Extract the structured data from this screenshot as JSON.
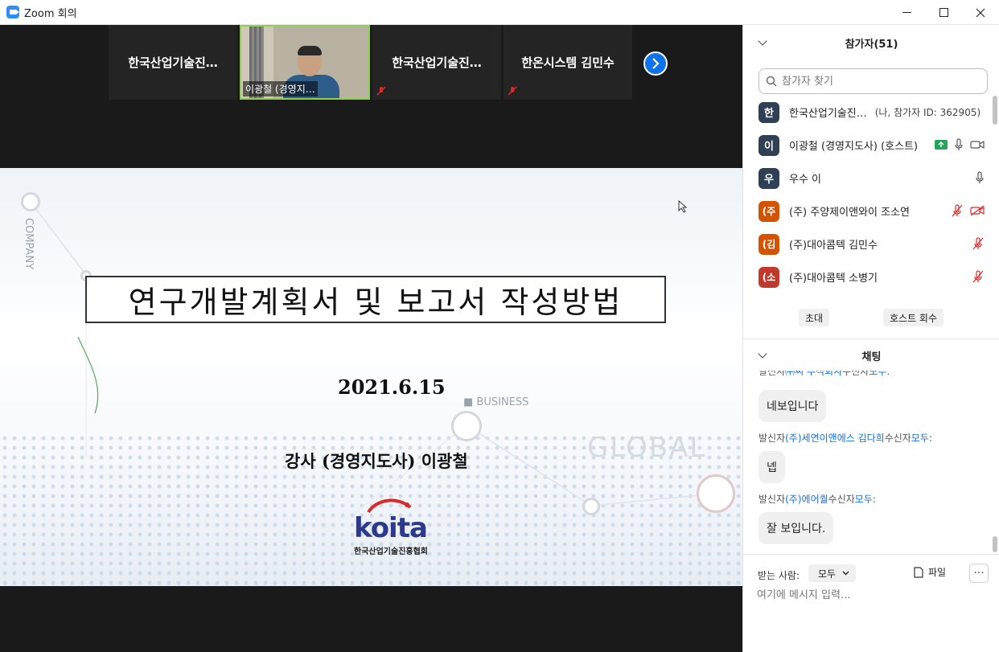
{
  "window": {
    "title": "Zoom 회의",
    "minimize": "–",
    "maximize": "☐",
    "close": "✕"
  },
  "gallery": {
    "tiles": [
      {
        "name": "한국산업기술진…"
      },
      {
        "name": "이광철 (경영지…",
        "active": true
      },
      {
        "name": "한국산업기술진…"
      },
      {
        "name": "한온시스템 김민수"
      }
    ]
  },
  "slide": {
    "title": "연구개발계획서 및 보고서 작성방법",
    "date": "2021.6.15",
    "presenter": "강사 (경영지도사) 이광철",
    "logo_text": "koita",
    "logo_sub": "한국산업기술진흥협회",
    "label_company": "COMPANY",
    "label_business": "■ BUSINESS",
    "label_global": "GLOBAL"
  },
  "participants": {
    "header": "참가자(51)",
    "search_placeholder": "참가자 찾기",
    "list": [
      {
        "initial": "한",
        "color": "#2f4054",
        "name": "한국산업기술진…",
        "meta": "(나, 참가자 ID: 362905)"
      },
      {
        "initial": "이",
        "color": "#2f4054",
        "name": "이광철 (경영지도사) (호스트)",
        "meta": ""
      },
      {
        "initial": "우",
        "color": "#2f4054",
        "name": "우수 이",
        "meta": ""
      },
      {
        "initial": "(주",
        "color": "#d35400",
        "name": "(주) 주양제이앤와이 조소연",
        "meta": ""
      },
      {
        "initial": "(김",
        "color": "#d35400",
        "name": "(주)대아콤텍 김민수",
        "meta": ""
      },
      {
        "initial": "(소",
        "color": "#c0392b",
        "name": "(주)대아콤텍 소병기",
        "meta": ""
      }
    ],
    "invite_label": "초대",
    "reclaim_host_label": "호스트 회수"
  },
  "chat": {
    "header": "채팅",
    "messages": [
      {
        "sender_prefix": "발신자",
        "sender": "㈜씨 주식회사",
        "to_prefix": "수신자",
        "to": "모두",
        "text": "네보입니다",
        "partial": true
      },
      {
        "sender_prefix": "발신자",
        "sender": "(주)세연이앤에스 김다희",
        "to_prefix": "수신자",
        "to": "모두",
        "text": "넵"
      },
      {
        "sender_prefix": "발신자",
        "sender": "(주)에어퀄",
        "to_prefix": "수신자",
        "to": "모두",
        "text": "잘 보입니다."
      }
    ],
    "to_label": "받는 사람:",
    "to_value": "모두",
    "file_label": "파일",
    "more_label": "···",
    "input_placeholder": "여기에 메시지 입력..."
  }
}
